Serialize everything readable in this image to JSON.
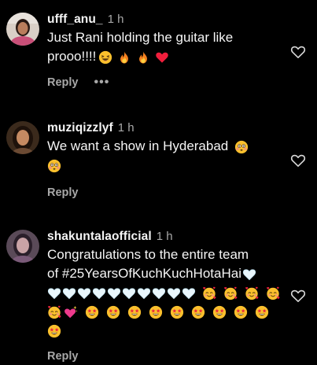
{
  "comments": [
    {
      "username": "ufff_anu_",
      "time": "1 h",
      "lines": [
        "Just Rani holding the guitar like",
        "prooo!!!!"
      ],
      "reply_label": "Reply",
      "more_label": "•••"
    },
    {
      "username": "muziqizzlyf",
      "time": "1 h",
      "lines": [
        "We want a show in Hyderabad"
      ],
      "reply_label": "Reply"
    },
    {
      "username": "shakuntalaofficial",
      "time": "1 h",
      "lines": [
        "Congratulations to the entire team",
        "of #25YearsOfKuchKuchHotaHai"
      ],
      "reply_label": "Reply"
    }
  ],
  "colors": {
    "background": "#000000",
    "text": "#f5f5f5",
    "secondary": "#a8a8a8"
  },
  "icons": {
    "like": "heart-outline-icon",
    "more": "more-dots-icon"
  }
}
